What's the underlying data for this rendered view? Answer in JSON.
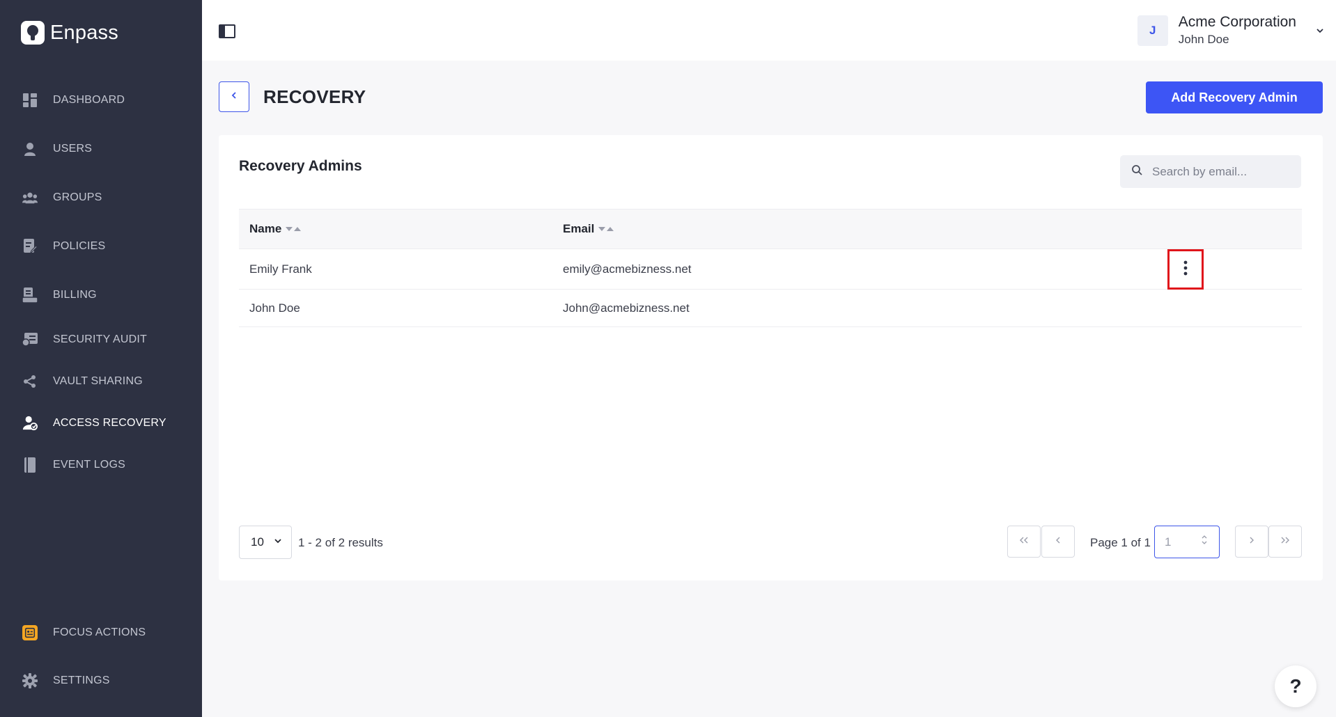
{
  "brand": {
    "name": "Enpass"
  },
  "sidebar": {
    "items": [
      {
        "label": "DASHBOARD",
        "icon": "dashboard-icon"
      },
      {
        "label": "USERS",
        "icon": "user-icon"
      },
      {
        "label": "GROUPS",
        "icon": "groups-icon"
      },
      {
        "label": "POLICIES",
        "icon": "policies-icon"
      },
      {
        "label": "BILLING",
        "icon": "billing-icon"
      },
      {
        "label": "SECURITY AUDIT",
        "icon": "security-audit-icon"
      },
      {
        "label": "VAULT SHARING",
        "icon": "share-icon"
      },
      {
        "label": "ACCESS RECOVERY",
        "icon": "access-recovery-icon",
        "active": true
      },
      {
        "label": "EVENT LOGS",
        "icon": "event-logs-icon"
      }
    ],
    "bottom": [
      {
        "label": "FOCUS ACTIONS",
        "icon": "focus-actions-icon"
      },
      {
        "label": "SETTINGS",
        "icon": "gear-icon"
      }
    ]
  },
  "header": {
    "org_initial": "J",
    "org_name": "Acme Corporation",
    "user_name": "John Doe"
  },
  "page": {
    "title": "RECOVERY",
    "primary_action": "Add Recovery Admin"
  },
  "card": {
    "title": "Recovery Admins",
    "search_placeholder": "Search by email..."
  },
  "table": {
    "columns": [
      "Name",
      "Email"
    ],
    "rows": [
      {
        "name": "Emily Frank",
        "email": "emily@acmebizness.net"
      },
      {
        "name": "John Doe",
        "email": "John@acmebizness.net"
      }
    ]
  },
  "pagination": {
    "page_size": "10",
    "results": "1 - 2 of 2 results",
    "page_label": "Page 1 of 1",
    "current_page": "1"
  },
  "help": {
    "label": "?"
  },
  "colors": {
    "sidebar_bg": "#2d3142",
    "accent": "#3d55f5",
    "highlight": "#e0151b",
    "focus_actions_icon": "#f5a623"
  }
}
